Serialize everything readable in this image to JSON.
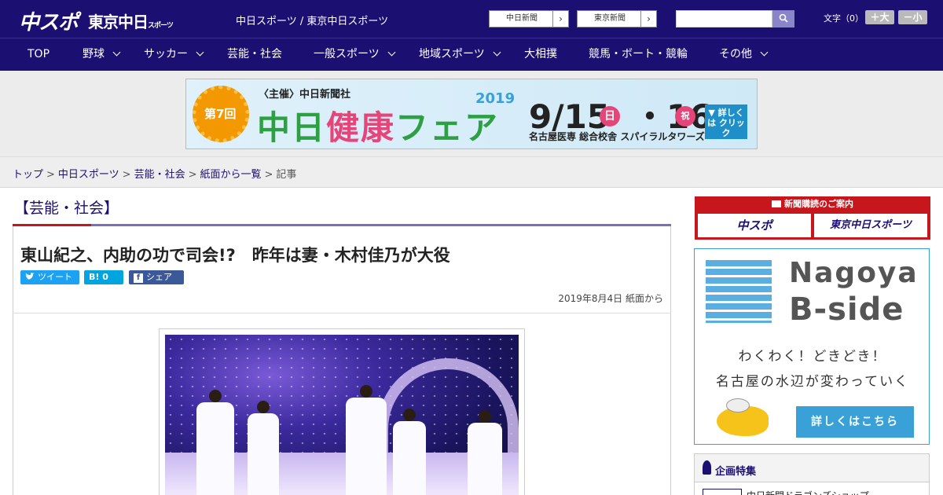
{
  "header": {
    "logo_main": "中スポ",
    "logo_tokyo": "東京中日",
    "logo_tokyo_sub": "スポーツ",
    "site_title": "中日スポーツ / 東京中日スポーツ",
    "paper_links": [
      "中日新聞",
      "東京新聞"
    ],
    "arrow": "›",
    "font_size_label": "文字（0）",
    "font_bigger": "＋大",
    "font_smaller": "－小"
  },
  "nav": [
    "TOP",
    "野球",
    "サッカー",
    "芸能・社会",
    "一般スポーツ",
    "地域スポーツ",
    "大相撲",
    "競馬・ボート・競輪",
    "その他"
  ],
  "banner": {
    "sponsor": "〈主催〉中日新聞社",
    "edition": "第7回",
    "year": "2019",
    "title_a": "中日",
    "title_b": "健康",
    "title_c": "フェア",
    "date_a": "9/15",
    "day_a": "日",
    "date_b": "・16",
    "day_b": "祝",
    "venue": "名古屋医専 総合校舎 スパイラルタワーズ",
    "cta": "▼ 詳しくは クリック"
  },
  "breadcrumb": [
    "トップ",
    "中日スポーツ",
    "芸能・社会",
    "紙面から一覧",
    "記事"
  ],
  "breadcrumb_sep": ">",
  "article": {
    "category": "【芸能・社会】",
    "headline": "東山紀之、内助の功で司会!?　昨年は妻・木村佳乃が大役",
    "share_tweet": "ツイート",
    "share_hatena": "B! 0",
    "share_facebook": "シェア 0",
    "dateline": "2019年8月4日 紙面から"
  },
  "sidebar": {
    "subscribe_head": "新聞購読のご案内",
    "subscribe_btn1": "中スポ",
    "subscribe_btn2": "東京中日スポーツ",
    "nb_title1": "Nagoya",
    "nb_title2": "B-side",
    "nb_line1": "わくわく！どきどき！",
    "nb_line2": "名古屋の水辺が変わっていく",
    "nb_button": "詳しくはこちら",
    "feature_title": "企画特集",
    "feature_item": "中日新聞ドラゴンズショップ"
  },
  "colors": {
    "brand": "#1b0f72",
    "accent_red": "#c8161d",
    "accent_blue": "#3aa0d8"
  }
}
